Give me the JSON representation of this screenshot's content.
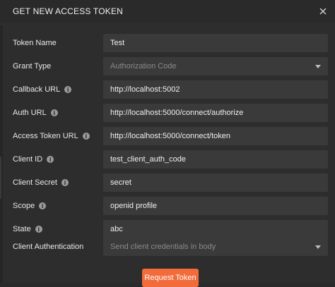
{
  "dialog": {
    "title": "GET NEW ACCESS TOKEN",
    "close_icon": "close-icon"
  },
  "fields": {
    "token_name": {
      "label": "Token Name",
      "value": "Test"
    },
    "grant_type": {
      "label": "Grant Type",
      "value": "Authorization Code"
    },
    "callback_url": {
      "label": "Callback URL",
      "value": "http://localhost:5002"
    },
    "auth_url": {
      "label": "Auth URL",
      "value": "http://localhost:5000/connect/authorize"
    },
    "access_token_url": {
      "label": "Access Token URL",
      "value": "http://localhost:5000/connect/token"
    },
    "client_id": {
      "label": "Client ID",
      "value": "test_client_auth_code"
    },
    "client_secret": {
      "label": "Client Secret",
      "value": "secret"
    },
    "scope": {
      "label": "Scope",
      "value": "openid profile"
    },
    "state": {
      "label": "State",
      "value": "abc"
    },
    "client_authentication": {
      "label": "Client Authentication",
      "value": "Send client credentials in body"
    }
  },
  "actions": {
    "request_token": "Request Token"
  },
  "colors": {
    "accent": "#f26b3a",
    "background": "#2d2d2d",
    "field": "#3a3a3a"
  }
}
